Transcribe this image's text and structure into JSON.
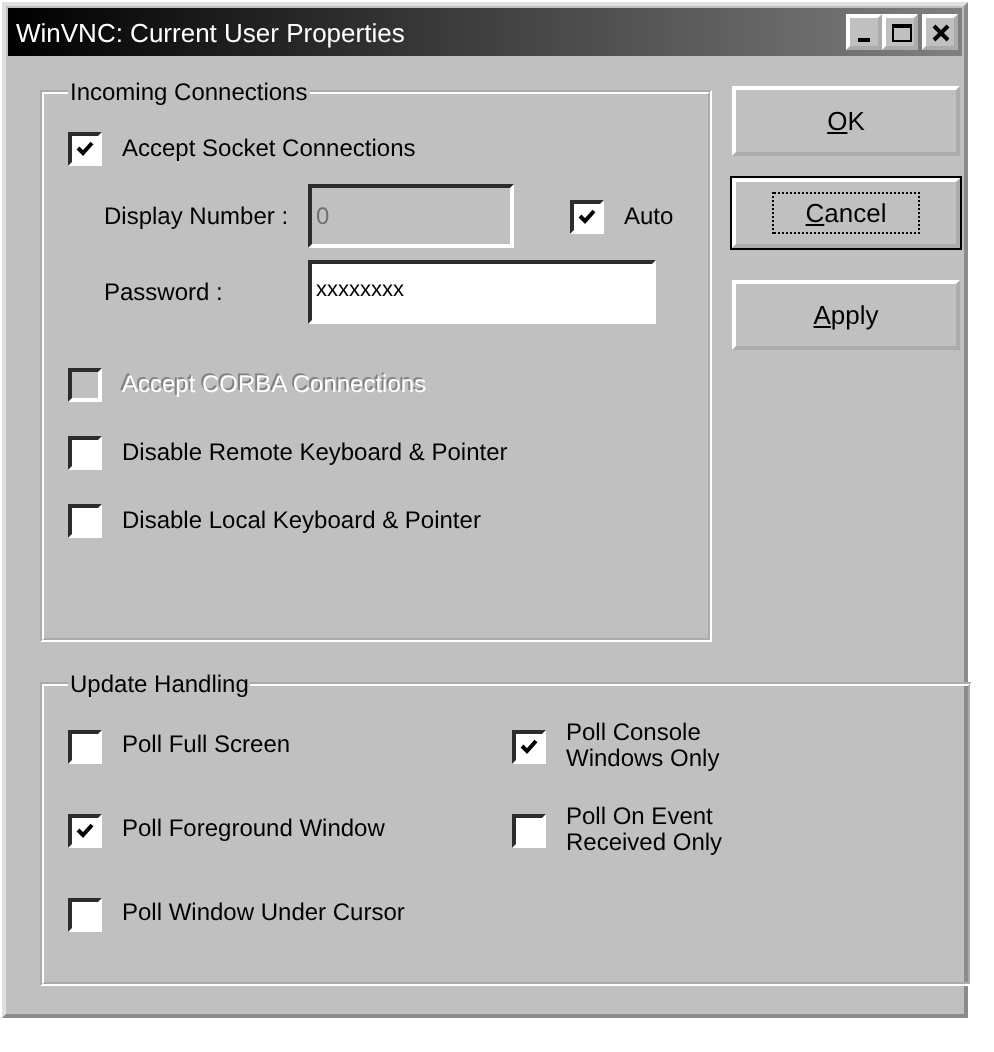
{
  "window": {
    "title": "WinVNC: Current User Properties"
  },
  "incoming": {
    "title": "Incoming Connections",
    "items": [
      {
        "kind": "checkbox",
        "label": "Accept Socket Connections",
        "checked": true,
        "disabled": false
      },
      {
        "kind": "display",
        "label": "Display Number :",
        "value": "0",
        "disabled": true,
        "auto": {
          "label": "Auto",
          "checked": true
        }
      },
      {
        "kind": "password",
        "label": "Password :",
        "value": "xxxxxxxx"
      },
      {
        "kind": "checkbox",
        "label": "Accept CORBA Connections",
        "checked": false,
        "disabled": true
      },
      {
        "kind": "checkbox",
        "label": "Disable Remote Keyboard & Pointer",
        "checked": false,
        "disabled": false
      },
      {
        "kind": "checkbox",
        "label": "Disable Local Keyboard & Pointer",
        "checked": false,
        "disabled": false
      }
    ]
  },
  "buttons": [
    {
      "accel": "O",
      "rest": "K",
      "default": false,
      "focused": false
    },
    {
      "accel": "C",
      "rest": "ancel",
      "default": true,
      "focused": true
    },
    {
      "accel": "A",
      "rest": "pply",
      "default": false,
      "focused": false
    }
  ],
  "update": {
    "title": "Update Handling",
    "items": [
      {
        "label": "Poll Full Screen",
        "checked": false
      },
      {
        "label": "Poll Console\nWindows Only",
        "checked": true
      },
      {
        "label": "Poll Foreground Window",
        "checked": true
      },
      {
        "label": "Poll On Event\nReceived Only",
        "checked": false
      },
      {
        "label": "Poll Window Under Cursor",
        "checked": false
      }
    ]
  }
}
